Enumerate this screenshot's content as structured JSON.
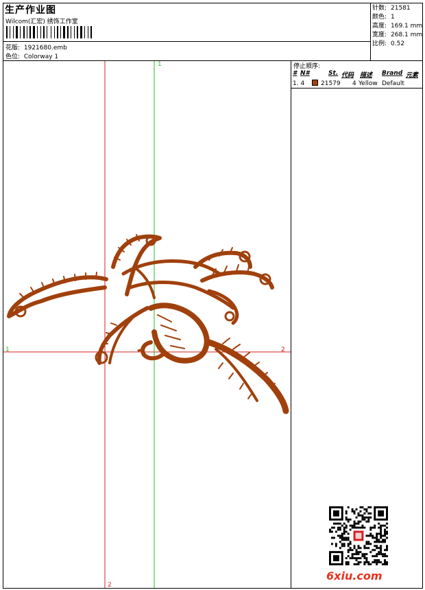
{
  "header": {
    "title": "生产作业图",
    "company": "Wilcom(汇宏) 绣饰工作室",
    "design_label": "花版:",
    "design_value": "1921680.emb",
    "colorway_label": "色位:",
    "colorway_value": "Colorway 1"
  },
  "stats": [
    {
      "label": "针数:",
      "value": "21581"
    },
    {
      "label": "颜色:",
      "value": "1"
    },
    {
      "label": "高度:",
      "value": "169.1 mm"
    },
    {
      "label": "宽度:",
      "value": "268.1 mm"
    },
    {
      "label": "比例:",
      "value": "0.52"
    }
  ],
  "stop_sequence": {
    "title": "停止顺序:",
    "columns": [
      "#",
      "N#",
      "St.",
      "代码",
      "描述",
      "Brand",
      "元素"
    ],
    "rows": [
      {
        "index": "1. 4",
        "color": "#a0400c",
        "stitches": "21579",
        "code": "4",
        "description": "Yellow",
        "brand": "Default",
        "element": ""
      }
    ]
  },
  "guides": {
    "h_left": "1",
    "h_right": "2",
    "v_top": "1",
    "v_bottom": "2",
    "h_color": "#d42020",
    "v_color": "#20c020"
  },
  "embroidery": {
    "color": "#a0400c",
    "subject": "phoenix-embroidery"
  },
  "watermark": {
    "site": "6xiu.com"
  }
}
